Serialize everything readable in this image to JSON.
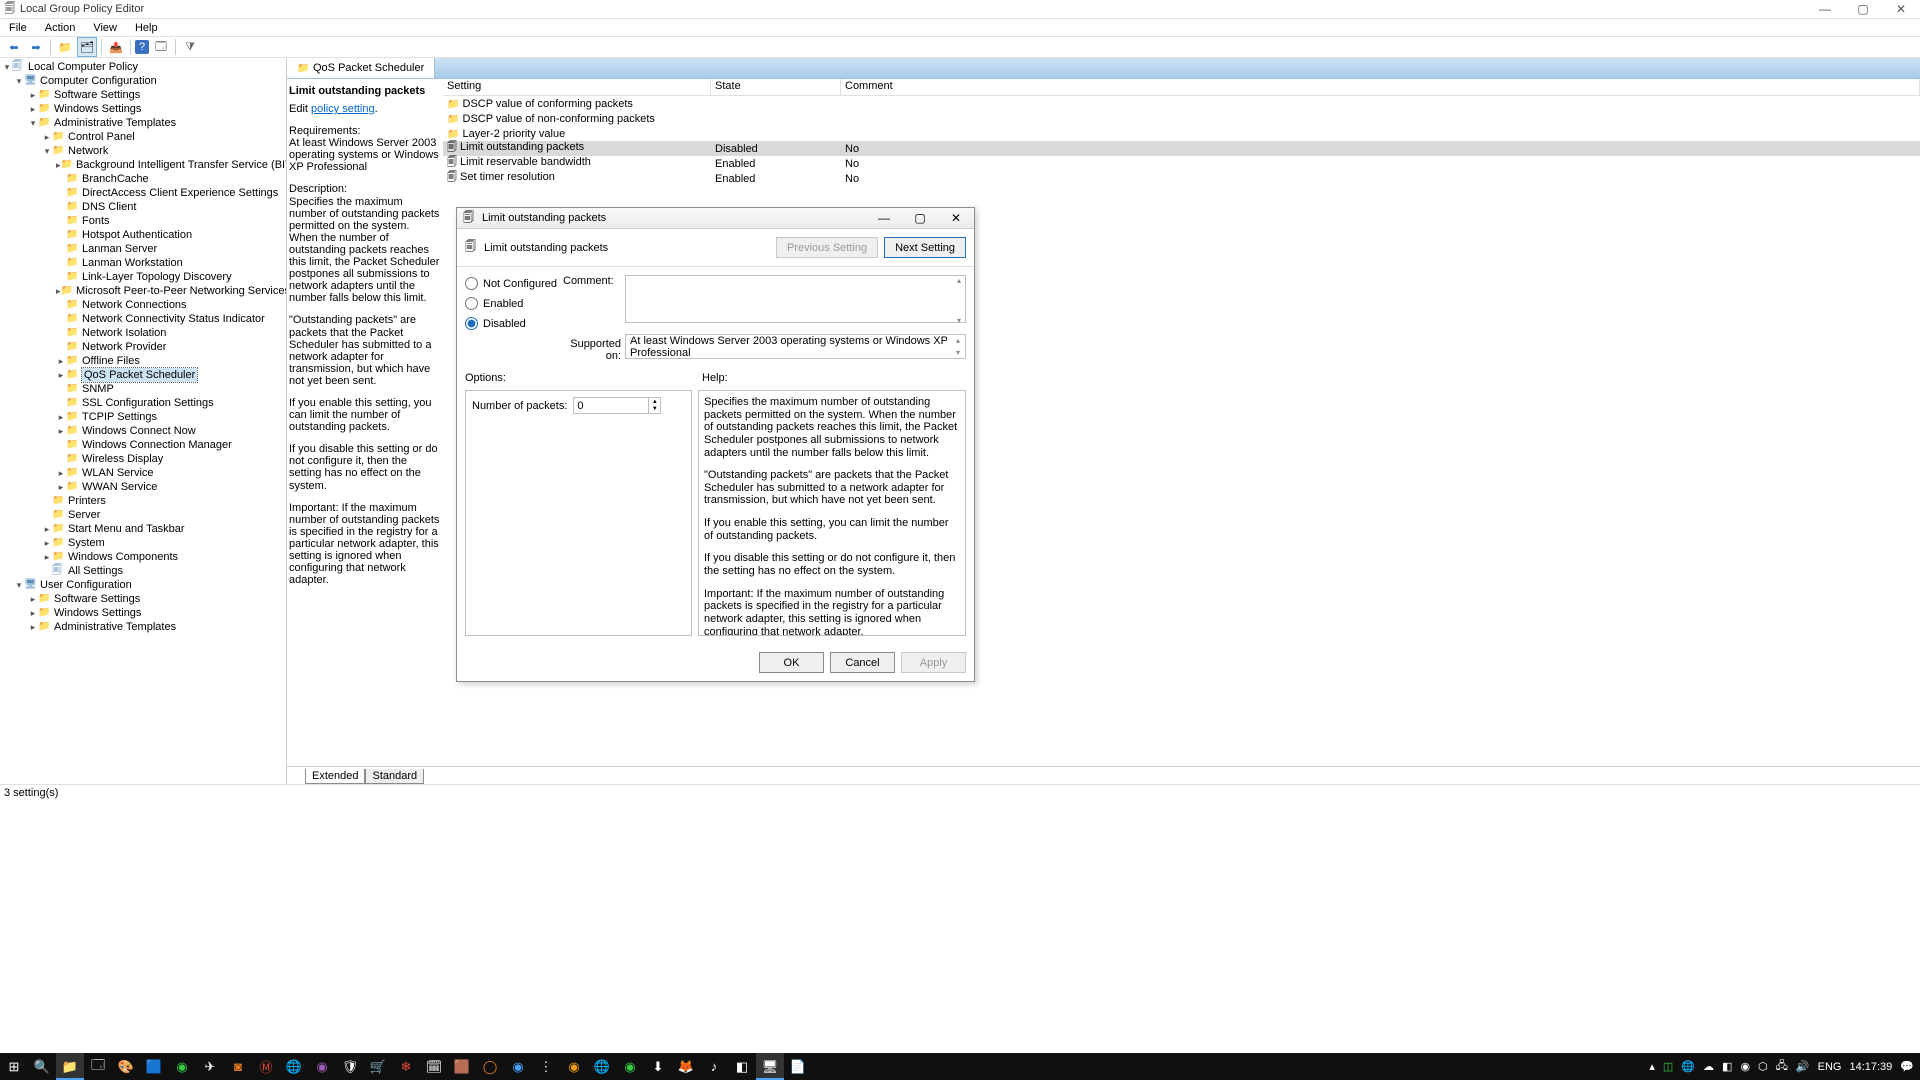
{
  "title": "Local Group Policy Editor",
  "menu": [
    "File",
    "Action",
    "View",
    "Help"
  ],
  "tree": {
    "root": "Local Computer Policy",
    "cc": "Computer Configuration",
    "cc_children": [
      "Software Settings",
      "Windows Settings",
      "Administrative Templates"
    ],
    "at_children": [
      "Control Panel",
      "Network",
      "Printers",
      "Server",
      "Start Menu and Taskbar",
      "System",
      "Windows Components",
      "All Settings"
    ],
    "net_children": [
      "Background Intelligent Transfer Service (BITS)",
      "BranchCache",
      "DirectAccess Client Experience Settings",
      "DNS Client",
      "Fonts",
      "Hotspot Authentication",
      "Lanman Server",
      "Lanman Workstation",
      "Link-Layer Topology Discovery",
      "Microsoft Peer-to-Peer Networking Services",
      "Network Connections",
      "Network Connectivity Status Indicator",
      "Network Isolation",
      "Network Provider",
      "Offline Files",
      "QoS Packet Scheduler",
      "SNMP",
      "SSL Configuration Settings",
      "TCPIP Settings",
      "Windows Connect Now",
      "Windows Connection Manager",
      "Wireless Display",
      "WLAN Service",
      "WWAN Service"
    ],
    "uc": "User Configuration",
    "uc_children": [
      "Software Settings",
      "Windows Settings",
      "Administrative Templates"
    ]
  },
  "scope_title": "QoS Packet Scheduler",
  "detail": {
    "heading": "Limit outstanding packets",
    "edit_prefix": "Edit ",
    "edit_link": "policy setting",
    "req_label": "Requirements:",
    "req_text": "At least Windows Server 2003 operating systems or Windows XP Professional",
    "desc_label": "Description:",
    "p1": "Specifies the maximum number of outstanding packets permitted on the system. When the number of outstanding packets reaches this limit, the Packet Scheduler postpones all submissions to network adapters until the number falls below this limit.",
    "p2": "\"Outstanding packets\" are packets that the Packet Scheduler has submitted to a network adapter for transmission, but which have not yet been sent.",
    "p3": "If you enable this setting, you can limit the number of outstanding packets.",
    "p4": "If you disable this setting or do not configure it, then the setting has no effect on the system.",
    "p5": "Important: If the maximum number of outstanding packets is specified in the registry for a particular network adapter, this setting is ignored when configuring that network adapter."
  },
  "list": {
    "cols": [
      "Setting",
      "State",
      "Comment"
    ],
    "rows": [
      {
        "s": "DSCP value of conforming packets",
        "st": "",
        "c": "",
        "folder": true
      },
      {
        "s": "DSCP value of non-conforming packets",
        "st": "",
        "c": "",
        "folder": true
      },
      {
        "s": "Layer-2 priority value",
        "st": "",
        "c": "",
        "folder": true
      },
      {
        "s": "Limit outstanding packets",
        "st": "Disabled",
        "c": "No",
        "folder": false,
        "sel": true
      },
      {
        "s": "Limit reservable bandwidth",
        "st": "Enabled",
        "c": "No",
        "folder": false
      },
      {
        "s": "Set timer resolution",
        "st": "Enabled",
        "c": "No",
        "folder": false
      }
    ]
  },
  "bottom_tabs": [
    "Extended",
    "Standard"
  ],
  "status": "3 setting(s)",
  "dialog": {
    "title": "Limit outstanding packets",
    "heading": "Limit outstanding packets",
    "prev": "Previous Setting",
    "next": "Next Setting",
    "r_nc": "Not Configured",
    "r_en": "Enabled",
    "r_di": "Disabled",
    "comment_label": "Comment:",
    "supported_label": "Supported on:",
    "supported_text": "At least Windows Server 2003 operating systems or Windows XP Professional",
    "options_label": "Options:",
    "help_label": "Help:",
    "num_label": "Number of packets:",
    "num_value": "0",
    "help1": "Specifies the maximum number of outstanding packets permitted on the system. When the number of outstanding packets reaches this limit, the Packet Scheduler postpones all submissions to network adapters until the number falls below this limit.",
    "help2": "\"Outstanding packets\" are packets that the Packet Scheduler has submitted to a network adapter for transmission, but which have not yet been sent.",
    "help3": "If you enable this setting, you can limit the number of outstanding packets.",
    "help4": "If you disable this setting or do not configure it, then the setting has no effect on the system.",
    "help5": "Important: If the maximum number of outstanding packets is specified in the registry for a particular network adapter, this setting is ignored when configuring that network adapter.",
    "ok": "OK",
    "cancel": "Cancel",
    "apply": "Apply"
  },
  "tray": {
    "lang": "ENG",
    "time": "14:17:39"
  }
}
